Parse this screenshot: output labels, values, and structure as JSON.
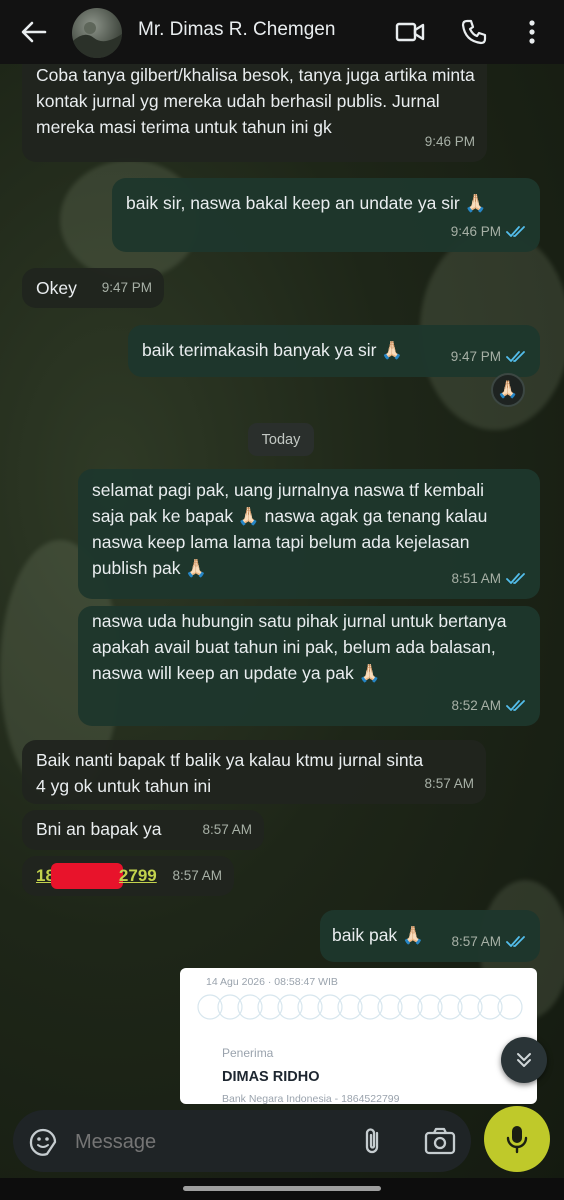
{
  "header": {
    "contact_name": "Mr. Dimas R. Chemgen"
  },
  "messages": [
    {
      "dir": "in",
      "text": "Coba tanya gilbert/khalisa besok, tanya juga artika minta kontak jurnal yg mereka udah berhasil publis. Jurnal mereka masi terima untuk tahun ini gk",
      "time": "9:46 PM"
    },
    {
      "dir": "out",
      "text": "baik sir, naswa bakal keep an undate ya sir 🙏🏻",
      "time": "9:46 PM"
    },
    {
      "dir": "in",
      "text": "Okey",
      "time": "9:47 PM"
    },
    {
      "dir": "out",
      "text": "baik terimakasih banyak ya sir 🙏🏻",
      "time": "9:47 PM",
      "reaction": "🙏🏻"
    },
    {
      "dir": "out",
      "text": "selamat pagi pak, uang jurnalnya naswa tf kembali saja pak ke bapak 🙏🏻 naswa agak ga tenang kalau naswa keep lama lama tapi belum ada kejelasan publish pak 🙏🏻",
      "time": "8:51 AM"
    },
    {
      "dir": "out",
      "text": "naswa uda hubungin satu pihak jurnal untuk bertanya apakah avail buat tahun ini pak, belum ada balasan, naswa will keep an update ya pak 🙏🏻",
      "time": "8:52 AM"
    },
    {
      "dir": "in",
      "text": "Baik nanti bapak tf balik ya kalau ktmu jurnal sinta 4 yg ok untuk tahun ini",
      "time": "8:57 AM"
    },
    {
      "dir": "in",
      "text": "Bni an bapak ya",
      "time": "8:57 AM"
    },
    {
      "dir": "in",
      "text_prefix": "18",
      "text_suffix": "2799",
      "time": "8:57 AM"
    },
    {
      "dir": "out",
      "text": "baik pak 🙏🏻",
      "time": "8:57 AM"
    }
  ],
  "date_divider": "Today",
  "receipt": {
    "timestamp": "14 Agu 2026 · 08:58:47 WIB",
    "label": "Penerima",
    "name": "DIMAS RIDHO",
    "bank_line": "Bank Negara Indonesia - 1864522799"
  },
  "composer": {
    "placeholder": "Message"
  },
  "colors": {
    "accent": "#bfc92a",
    "read_ticks": "#53bdeb",
    "outgoing_bubble": "#1e372c",
    "incoming_bubble": "#20241e"
  }
}
